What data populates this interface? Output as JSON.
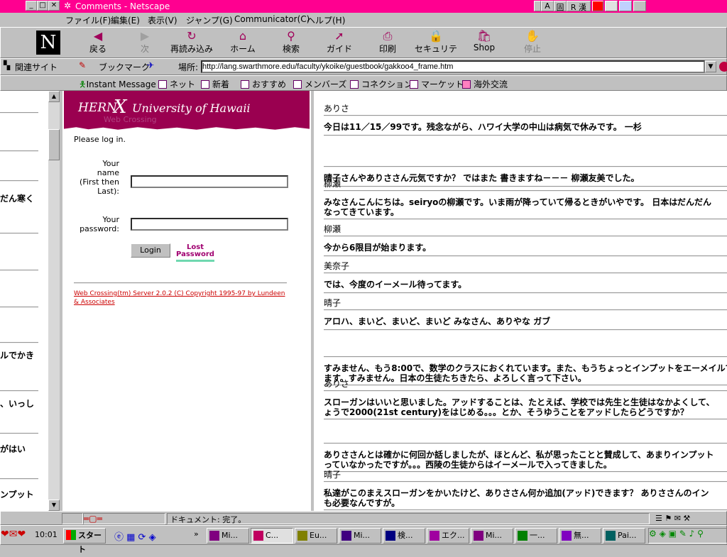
{
  "window": {
    "title": "Comments - Netscape"
  },
  "menu": [
    "ファイル(F)",
    "編集(E)",
    "表示(V)",
    "ジャンプ(G)",
    "Communicator(C)",
    "ヘルプ(H)"
  ],
  "ime": {
    "a": "A",
    "fixed": "固",
    "mode": "R 漢"
  },
  "toolbar": [
    {
      "label": "戻る",
      "icon": "back-arrow-icon",
      "glyph": "◀"
    },
    {
      "label": "次",
      "icon": "forward-arrow-icon",
      "glyph": "▶"
    },
    {
      "label": "再読み込み",
      "icon": "reload-icon",
      "glyph": "↻"
    },
    {
      "label": "ホーム",
      "icon": "home-icon",
      "glyph": "⌂"
    },
    {
      "label": "検索",
      "icon": "search-icon",
      "glyph": "⚲"
    },
    {
      "label": "ガイド",
      "icon": "guide-icon",
      "glyph": "➚"
    },
    {
      "label": "印刷",
      "icon": "print-icon",
      "glyph": "⎙"
    },
    {
      "label": "セキュリティ",
      "icon": "security-lock-icon",
      "glyph": "🔒"
    },
    {
      "label": "Shop",
      "icon": "shop-icon",
      "glyph": "🛍"
    },
    {
      "label": "停止",
      "icon": "stop-icon",
      "glyph": "✋"
    }
  ],
  "location": {
    "related": "関連サイト",
    "bookmarks": "ブックマーク",
    "label": "場所:",
    "url": "http://lang.swarthmore.edu/faculty/ykoike/guestbook/gakkoo4_frame.htm"
  },
  "personal": [
    "Instant Message",
    "ネット",
    "新着",
    "おすすめ",
    "メンバーズ",
    "コネクション",
    "マーケット",
    "海外交流"
  ],
  "left_frame_fragments": [
    "だん寒く",
    "ルでかき",
    "、いっし",
    "がはい",
    "ンプット"
  ],
  "login": {
    "banner_hern": "HERN",
    "banner_univ": "University of Hawaii",
    "banner_sub": "Web Crossing",
    "please": "Please log in.",
    "name_label": "Your name (First then Last):",
    "password_label": "Your password:",
    "login_button": "Login",
    "lost_line1": "Lost",
    "lost_line2": "Password",
    "copyright": "Web Crossing(tm) Server 2.0.2 (C) Copyright 1995-97 by Lundeen & Associates"
  },
  "messages": [
    {
      "author": "ありさ",
      "text": "今日は11／15／99です。残念ながら、ハワイ大学の中山は病気で休みです。 一杉"
    },
    {
      "author": "",
      "text": "晴子さんやありささん元気ですか？ ではまた 書きますね－－－ 柳瀬友美でした。"
    },
    {
      "author": "柳瀬",
      "text": "みなさんこんにちは。seiryoの柳瀬です。いま雨が降っていて帰るときがいやです。 日本はだんだん",
      "text2": "なってきています。"
    },
    {
      "author": "柳瀬",
      "text": "今から6限目が始まります。"
    },
    {
      "author": "美奈子",
      "text": "では、今度のイーメール待ってます。"
    },
    {
      "author": "晴子",
      "text": "アロハ、まいど、まいど、まいど みなさん、ありやな ガブ"
    },
    {
      "author": "",
      "text": "すみません、もう8:00で、数学のクラスにおくれています。また、もうちょっとインプットをエーメイルで",
      "text2": "ます。すみません。日本の生徒たちきたら、よろしく言って下さい。"
    },
    {
      "author": "ありさ",
      "text": "スローガンはいいと思いました。アッドすることは、たとえば、学校では先生と生徒はなかよくして、",
      "text2": "ょうで2000(21st century)をはじめる。。。とか、そうゆうことをアッドしたらどうですか？"
    },
    {
      "author": "",
      "text": "ありささんとは確かに何回か話しましたが、ほとんど、私が思ったことと賛成して、あまりインプット",
      "text2": "っていなかったですが。。。西陵の生徒からはイーメールで入ってきました。"
    },
    {
      "author": "晴子",
      "text": "私達がこのまえスローガンをかいたけど、ありささん何か追加(アッド)できます？ ありささんのイン",
      "text2": "も必要なんですが。"
    }
  ],
  "status": {
    "text": "ドキュメント: 完了。"
  },
  "taskbar": {
    "clock": "10:01",
    "start": "スタート",
    "tasks": [
      "Mi...",
      "C...",
      "Eu...",
      "Mi...",
      "検...",
      "エク...",
      "Mi...",
      "一...",
      "無...",
      "Pai..."
    ]
  },
  "colors": {
    "title": "#ff0090",
    "banner": "#9a0050",
    "link": "#cc0000"
  }
}
